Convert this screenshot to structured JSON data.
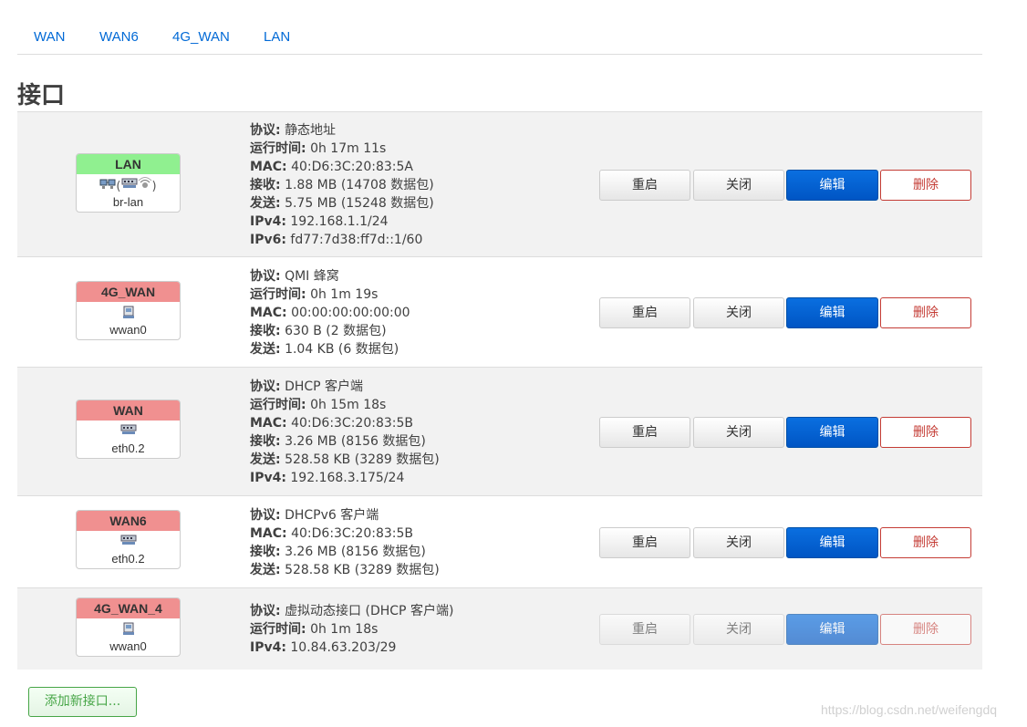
{
  "tabs": [
    "WAN",
    "WAN6",
    "4G_WAN",
    "LAN"
  ],
  "section_title": "接口",
  "labels": {
    "protocol": "协议:",
    "uptime": "运行时间:",
    "mac": "MAC:",
    "rx": "接收:",
    "tx": "发送:",
    "ipv4": "IPv4:",
    "ipv6": "IPv6:"
  },
  "buttons": {
    "restart": "重启",
    "stop": "关闭",
    "edit": "编辑",
    "delete": "删除"
  },
  "interfaces": [
    {
      "name": "LAN",
      "color": "#90f090",
      "device": "br-lan",
      "icons": [
        "network-bridge-icon",
        "ethernet-switch-icon",
        "wireless-icon"
      ],
      "icons_text": "(",
      "icons_text_end": ")",
      "enabled": true,
      "protocol": "静态地址",
      "uptime": "0h 17m 11s",
      "mac": "40:D6:3C:20:83:5A",
      "rx": "1.88 MB (14708 数据包)",
      "tx": "5.75 MB (15248 数据包)",
      "ipv4": "192.168.1.1/24",
      "ipv6": "fd77:7d38:ff7d::1/60"
    },
    {
      "name": "4G_WAN",
      "color": "#f09090",
      "device": "wwan0",
      "icons": [
        "modem-icon"
      ],
      "enabled": true,
      "protocol": "QMI 蜂窝",
      "uptime": "0h 1m 19s",
      "mac": "00:00:00:00:00:00",
      "rx": "630 B (2 数据包)",
      "tx": "1.04 KB (6 数据包)"
    },
    {
      "name": "WAN",
      "color": "#f09090",
      "device": "eth0.2",
      "icons": [
        "ethernet-switch-icon"
      ],
      "enabled": true,
      "protocol": "DHCP 客户端",
      "uptime": "0h 15m 18s",
      "mac": "40:D6:3C:20:83:5B",
      "rx": "3.26 MB (8156 数据包)",
      "tx": "528.58 KB (3289 数据包)",
      "ipv4": "192.168.3.175/24"
    },
    {
      "name": "WAN6",
      "color": "#f09090",
      "device": "eth0.2",
      "icons": [
        "ethernet-switch-icon"
      ],
      "enabled": true,
      "protocol": "DHCPv6 客户端",
      "mac": "40:D6:3C:20:83:5B",
      "rx": "3.26 MB (8156 数据包)",
      "tx": "528.58 KB (3289 数据包)"
    },
    {
      "name": "4G_WAN_4",
      "color": "#f09090",
      "device": "wwan0",
      "icons": [
        "modem-icon"
      ],
      "enabled": false,
      "protocol": "虚拟动态接口 (DHCP 客户端)",
      "uptime": "0h 1m 18s",
      "ipv4": "10.84.63.203/29"
    }
  ],
  "add_button": "添加新接口...",
  "watermark": "https://blog.csdn.net/weifengdq"
}
